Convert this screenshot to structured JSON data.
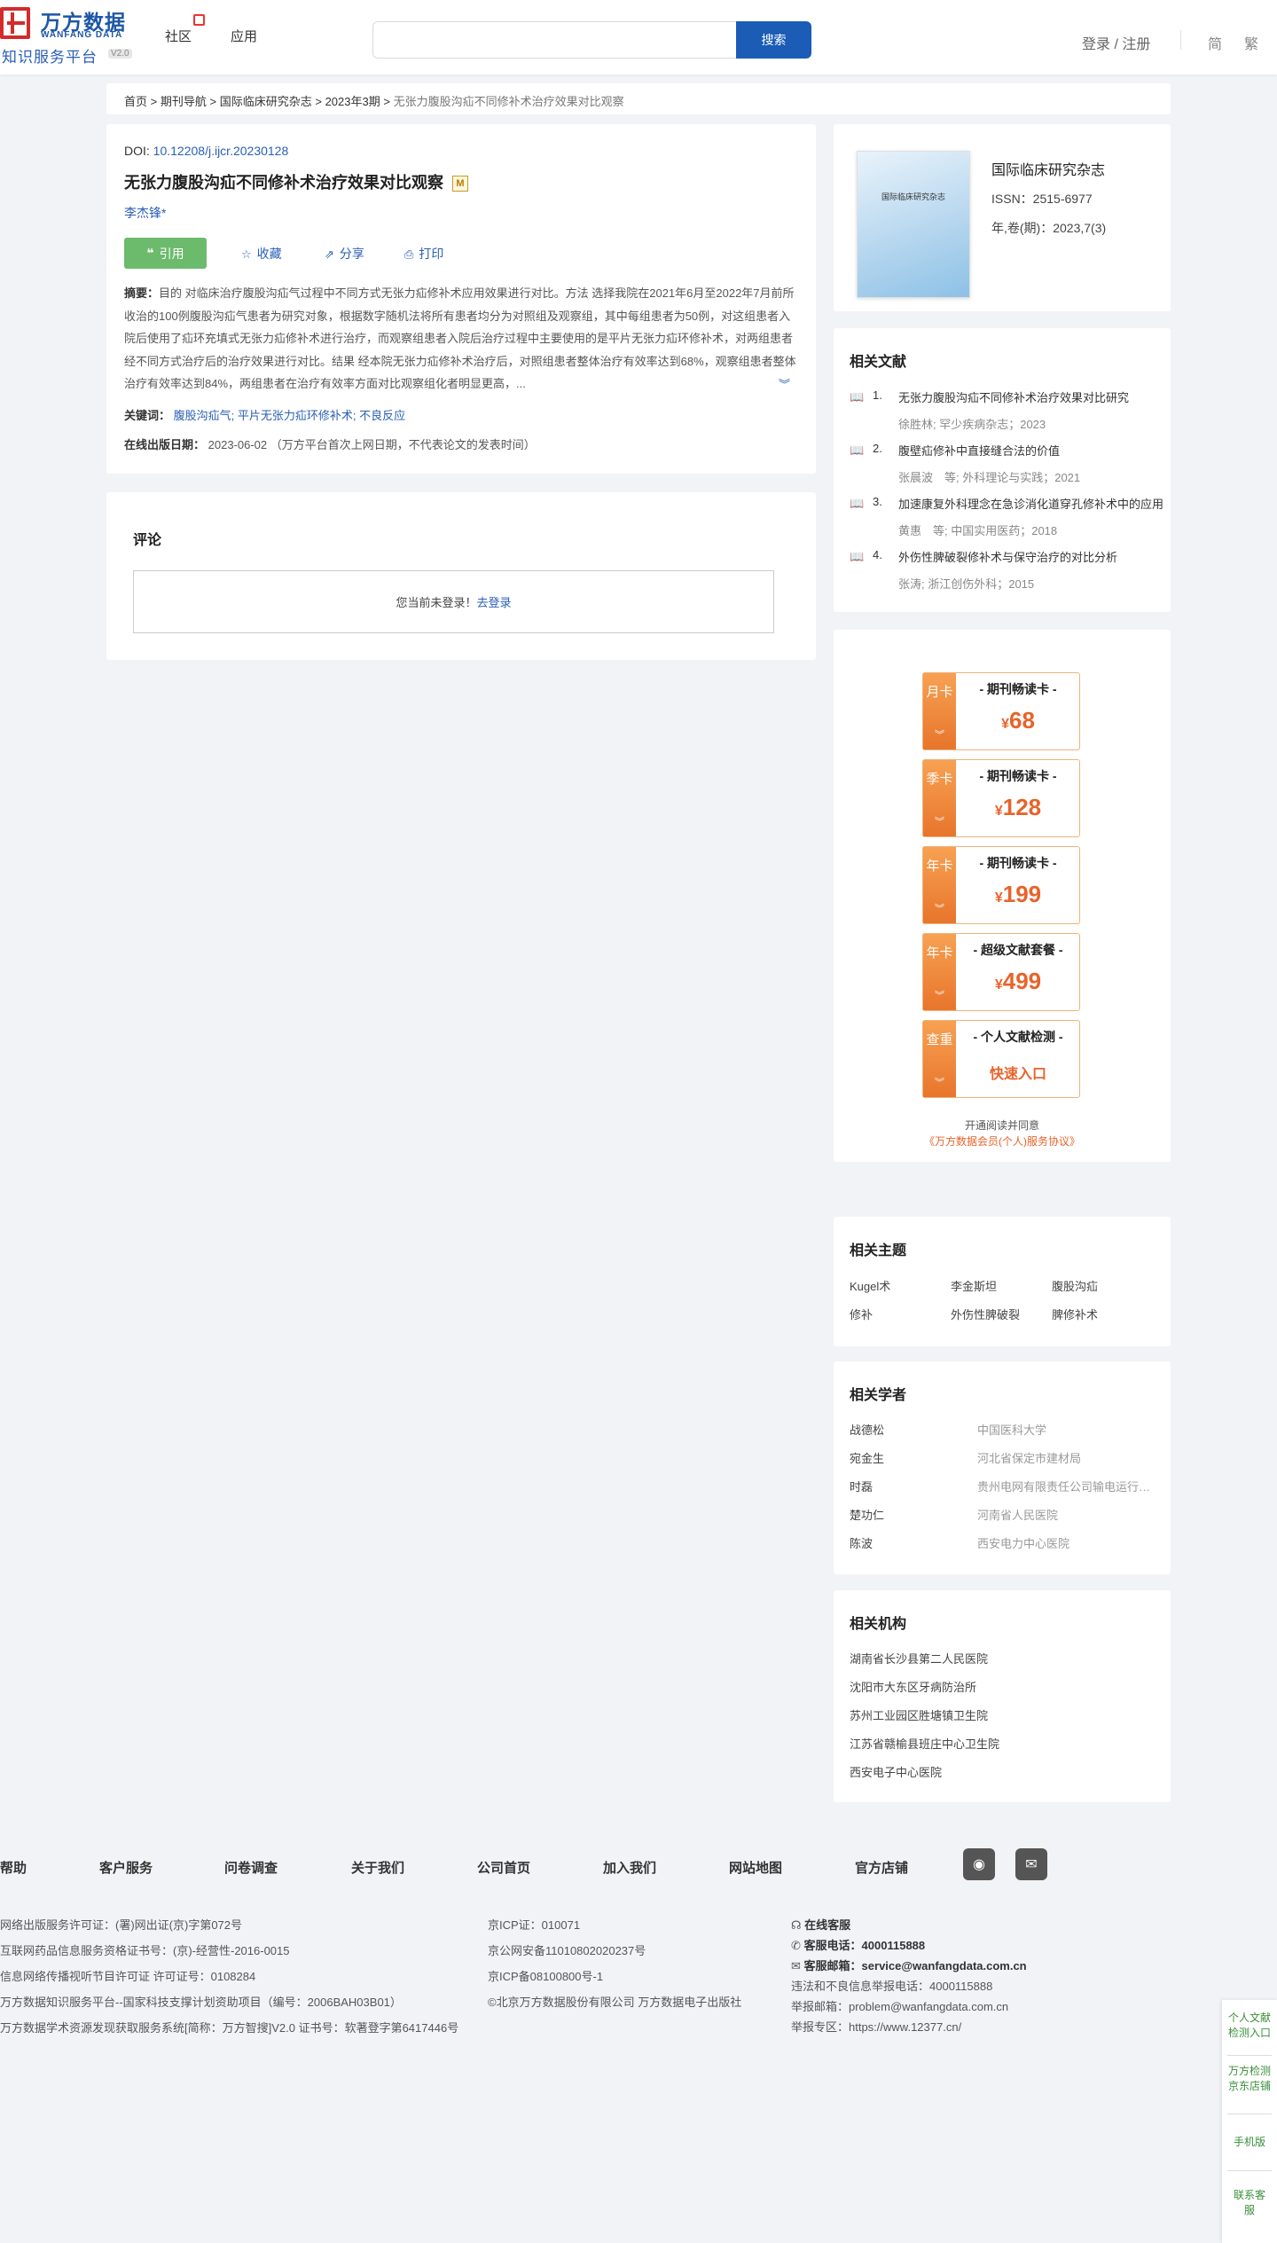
{
  "header": {
    "logo_cn": "万方数据",
    "logo_en": "WANFANG DATA",
    "logo_sub": "知识服务平台",
    "logo_version": "V2.0",
    "nav": [
      "社区",
      "应用"
    ],
    "search_placeholder": "",
    "search_button": "搜索",
    "login": "登录 / 注册",
    "lang_simplified": "简",
    "lang_traditional": "繁"
  },
  "breadcrumb": [
    "首页",
    "期刊导航",
    "国际临床研究杂志",
    "2023年3期",
    "无张力腹股沟疝不同修补术治疗效果对比观察"
  ],
  "breadcrumb_sep": ">",
  "article": {
    "doi_label": "DOI:",
    "doi": "10.12208/j.ijcr.20230128",
    "title": "无张力腹股沟疝不同修补术治疗效果对比观察",
    "m_badge": "M",
    "author": "李杰锋*",
    "actions": {
      "cite": "引用",
      "favorite": "收藏",
      "share": "分享",
      "print": "打印"
    },
    "abstract_label": "摘要：",
    "abstract": "目的 对临床治疗腹股沟疝气过程中不同方式无张力疝修补术应用效果进行对比。方法 选择我院在2021年6月至2022年7月前所收治的100例腹股沟疝气患者为研究对象，根据数字随机法将所有患者均分为对照组及观察组，其中每组患者为50例，对这组患者入院后使用了疝环充填式无张力疝修补术进行治疗，而观察组患者入院后治疗过程中主要使用的是平片无张力疝环修补术，对两组患者经不同方式治疗后的治疗效果进行对比。结果 经本院无张力疝修补术治疗后，对照组患者整体治疗有效率达到68%，观察组患者整体治疗有效率达到84%，两组患者在治疗有效率方面对比观察组化者明显更高，...",
    "keywords_label": "关键词：",
    "keywords": [
      "腹股沟疝气",
      "平片无张力疝环修补术",
      "不良反应"
    ],
    "keyword_sep": ";",
    "pub_label": "在线出版日期：",
    "pub_date": "2023-06-02",
    "pub_note": "（万方平台首次上网日期，不代表论文的发表时间）"
  },
  "comments": {
    "title": "评论",
    "not_logged": "您当前未登录！",
    "login_link": "去登录"
  },
  "journal": {
    "cover_text": "国际临床研究杂志",
    "name": "国际临床研究杂志",
    "issn": "ISSN：2515-6977",
    "vol": "年,卷(期)：2023,7(3)"
  },
  "related_papers": {
    "title": "相关文献",
    "items": [
      {
        "n": "1.",
        "title": "无张力腹股沟疝不同修补术治疗效果对比研究",
        "meta": "徐胜林; 罕少疾病杂志；2023"
      },
      {
        "n": "2.",
        "title": "腹壁疝修补中直接缝合法的价值",
        "meta": "张晨波　等; 外科理论与实践；2021"
      },
      {
        "n": "3.",
        "title": "加速康复外科理念在急诊消化道穿孔修补术中的应用",
        "meta": "黄惠　等; 中国实用医药；2018"
      },
      {
        "n": "4.",
        "title": "外伤性脾破裂修补术与保守治疗的对比分析",
        "meta": "张涛; 浙江创伤外科；2015"
      }
    ]
  },
  "promo": {
    "cards": [
      {
        "side": "月卡",
        "title": "- 期刊畅读卡 -",
        "currency": "¥",
        "price": "68"
      },
      {
        "side": "季卡",
        "title": "- 期刊畅读卡 -",
        "currency": "¥",
        "price": "128"
      },
      {
        "side": "年卡",
        "title": "- 期刊畅读卡 -",
        "currency": "¥",
        "price": "199"
      },
      {
        "side": "年卡",
        "title": "- 超级文献套餐 -",
        "currency": "¥",
        "price": "499"
      },
      {
        "side": "查重",
        "title": "- 个人文献检测 -",
        "quick": "快速入口"
      }
    ],
    "note1": "开通阅读并同意",
    "note2": "《万方数据会员(个人)服务协议》"
  },
  "topics": {
    "title": "相关主题",
    "items": [
      "Kugel术",
      "李金斯坦",
      "腹股沟疝",
      "修补",
      "外伤性脾破裂",
      "脾修补术"
    ]
  },
  "scholars": {
    "title": "相关学者",
    "items": [
      {
        "name": "战德松",
        "org": "中国医科大学"
      },
      {
        "name": "宛金生",
        "org": "河北省保定市建材局"
      },
      {
        "name": "时磊",
        "org": "贵州电网有限责任公司输电运行检修分公司"
      },
      {
        "name": "楚功仁",
        "org": "河南省人民医院"
      },
      {
        "name": "陈波",
        "org": "西安电力中心医院"
      }
    ]
  },
  "institutions": {
    "title": "相关机构",
    "items": [
      "湖南省长沙县第二人民医院",
      "沈阳市大东区牙病防治所",
      "苏州工业园区胜塘镇卫生院",
      "江苏省赣榆县班庄中心卫生院",
      "西安电子中心医院"
    ]
  },
  "footer": {
    "links": [
      "帮助",
      "客户服务",
      "问卷调查",
      "关于我们",
      "公司首页",
      "加入我们",
      "网站地图",
      "官方店铺"
    ],
    "col1": [
      "网络出版服务许可证：(署)网出证(京)字第072号",
      "互联网药品信息服务资格证书号：(京)-经营性-2016-0015",
      "信息网络传播视听节目许可证 许可证号：0108284",
      "万方数据知识服务平台--国家科技支撑计划资助项目（编号：2006BAH03B01）",
      "万方数据学术资源发现获取服务系统[简称：万方智搜]V2.0 证书号：软著登字第6417446号"
    ],
    "col2": [
      "京ICP证：010071",
      "京公网安备11010802020237号",
      "京ICP备08100800号-1",
      "©北京万方数据股份有限公司 万方数据电子出版社"
    ],
    "col3": {
      "online": "在线客服",
      "phone_label": "客服电话：",
      "phone": "4000115888",
      "email_label": "客服邮箱：",
      "email": "service@wanfangdata.com.cn",
      "report_phone": "违法和不良信息举报电话：4000115888",
      "report_email": "举报邮箱：problem@wanfangdata.com.cn",
      "report_zone": "举报专区：https://www.12377.cn/"
    }
  },
  "side_float": [
    "个人文献检测入口",
    "万方检测京东店铺",
    "手机版",
    "联系客服"
  ]
}
